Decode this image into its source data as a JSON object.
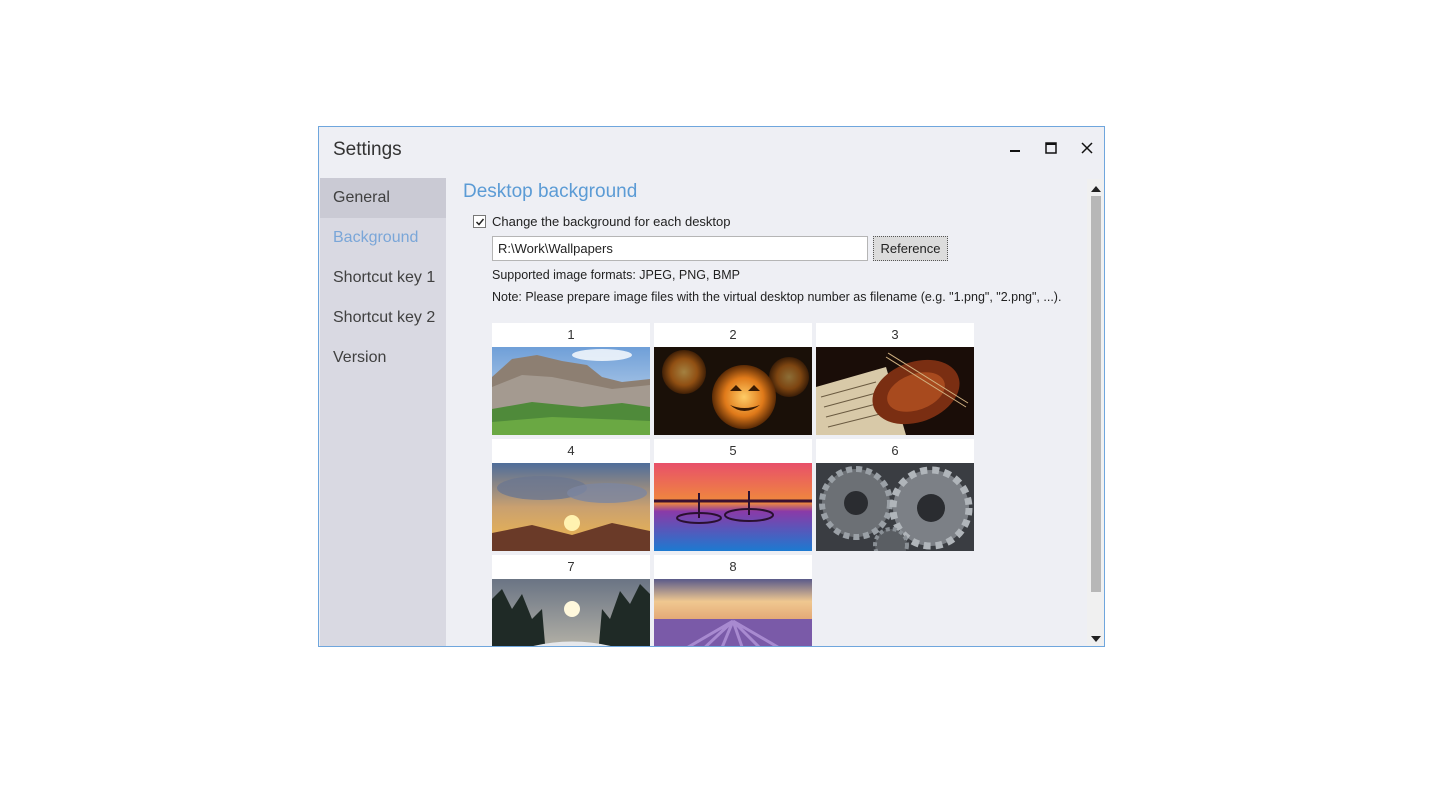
{
  "window": {
    "title": "Settings"
  },
  "sidebar": {
    "items": [
      {
        "label": "General"
      },
      {
        "label": "Background"
      },
      {
        "label": "Shortcut key 1"
      },
      {
        "label": "Shortcut key 2"
      },
      {
        "label": "Version"
      }
    ],
    "selected": "Background"
  },
  "background": {
    "title": "Desktop background",
    "checkbox_label": "Change the background for each desktop",
    "checkbox_checked": true,
    "path_value": "R:\\Work\\Wallpapers",
    "reference_label": "Reference",
    "formats_text": "Supported image formats: JPEG, PNG, BMP",
    "note_text": "Note: Please prepare image files with the virtual desktop number as filename (e.g. \"1.png\", \"2.png\", ...).",
    "wallpapers": [
      {
        "number": "1"
      },
      {
        "number": "2"
      },
      {
        "number": "3"
      },
      {
        "number": "4"
      },
      {
        "number": "5"
      },
      {
        "number": "6"
      },
      {
        "number": "7"
      },
      {
        "number": "8"
      }
    ]
  },
  "colors": {
    "accent": "#5b9bd5",
    "window_border": "#6fa6dd",
    "sidebar_bg": "#d9d9e2"
  },
  "icons": [
    "minimize-icon",
    "maximize-icon",
    "close-icon",
    "checkmark-icon",
    "scroll-up-arrow-icon",
    "scroll-down-arrow-icon"
  ]
}
